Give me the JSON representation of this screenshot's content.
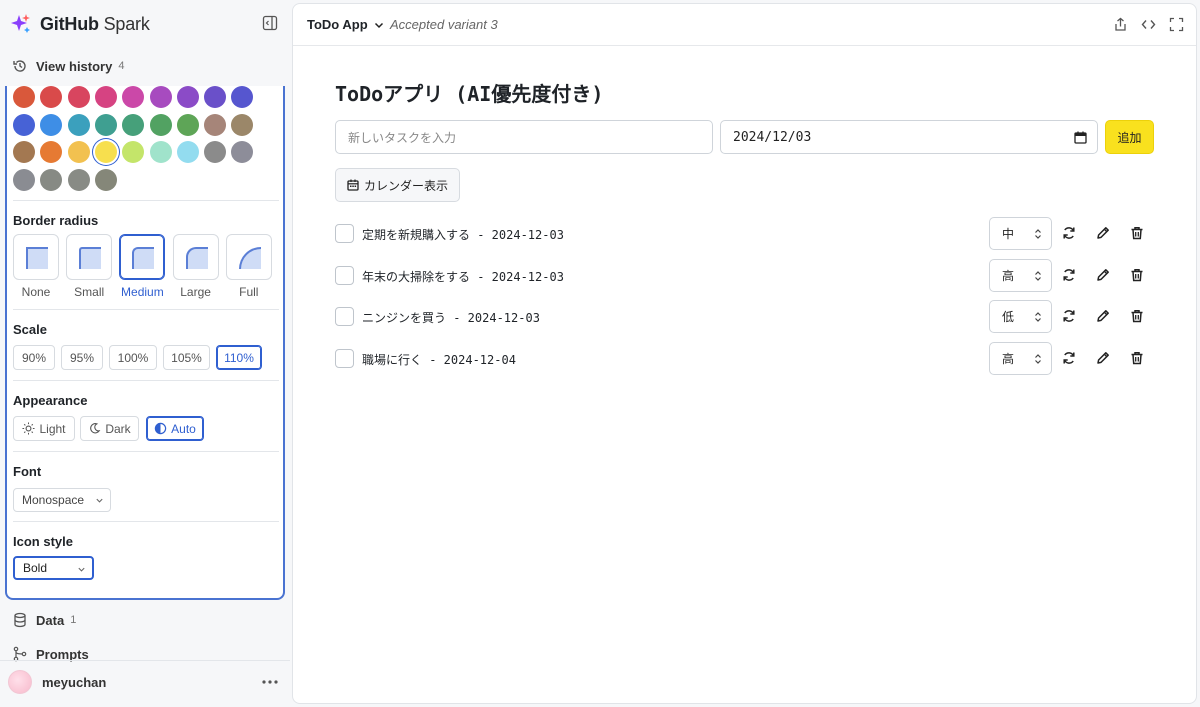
{
  "brand": {
    "name_bold": "GitHub",
    "name_light": "Spark"
  },
  "sidebar": {
    "history": {
      "label": "View history",
      "count": "4"
    },
    "data": {
      "label": "Data",
      "count": "1"
    },
    "prompts": {
      "label": "Prompts"
    },
    "user": {
      "name": "meyuchan"
    }
  },
  "theme_panel": {
    "swatch_colors": [
      "#d9583b",
      "#d94a4a",
      "#d8455f",
      "#d64382",
      "#cb48a8",
      "#a74bbf",
      "#8b4bc7",
      "#6a50c9",
      "#5656cf",
      "#4762d6",
      "#3e8ee6",
      "#3ba0bd",
      "#3f9f91",
      "#46a07a",
      "#52a262",
      "#5ea557",
      "#a68579",
      "#9b8769",
      "#a37851",
      "#e67a33",
      "#f2c150",
      "#f7df4e",
      "#c4e56a",
      "#a0e3cb",
      "#93dcef",
      "#8b8b8b",
      "#8d8d99",
      "#8a8c92",
      "#878a84",
      "#888b85",
      "#858779"
    ],
    "selected_swatch_index": 21,
    "border_radius": {
      "title": "Border radius",
      "options": [
        "None",
        "Small",
        "Medium",
        "Large",
        "Full"
      ],
      "selected": "Medium"
    },
    "scale": {
      "title": "Scale",
      "options": [
        "90%",
        "95%",
        "100%",
        "105%",
        "110%"
      ],
      "selected": "110%"
    },
    "appearance": {
      "title": "Appearance",
      "options": [
        "Light",
        "Dark",
        "Auto"
      ],
      "selected": "Auto"
    },
    "font": {
      "title": "Font",
      "value": "Monospace"
    },
    "icon_style": {
      "title": "Icon style",
      "value": "Bold"
    }
  },
  "topbar": {
    "app_name": "ToDo App",
    "variant": "Accepted variant 3"
  },
  "app": {
    "title": "ToDoアプリ (AI優先度付き)",
    "task_placeholder": "新しいタスクを入力",
    "date_value": "2024/12/03",
    "add_label": "追加",
    "calendar_label": "カレンダー表示",
    "tasks": [
      {
        "text": "定期を新規購入する - 2024-12-03",
        "priority": "中"
      },
      {
        "text": "年末の大掃除をする - 2024-12-03",
        "priority": "高"
      },
      {
        "text": "ニンジンを買う - 2024-12-03",
        "priority": "低"
      },
      {
        "text": "職場に行く - 2024-12-04",
        "priority": "高"
      }
    ]
  }
}
